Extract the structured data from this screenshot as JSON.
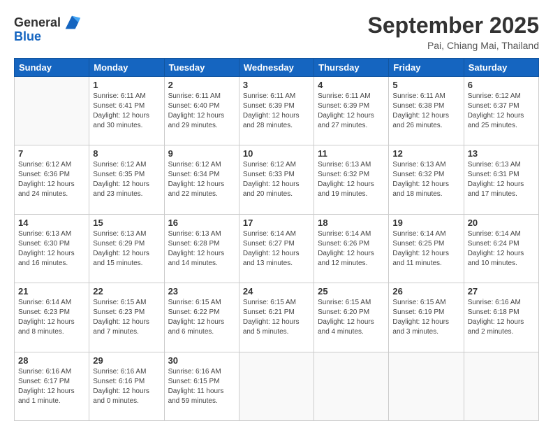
{
  "header": {
    "logo": {
      "line1": "General",
      "line2": "Blue"
    },
    "title": "September 2025",
    "subtitle": "Pai, Chiang Mai, Thailand"
  },
  "calendar": {
    "days_of_week": [
      "Sunday",
      "Monday",
      "Tuesday",
      "Wednesday",
      "Thursday",
      "Friday",
      "Saturday"
    ],
    "weeks": [
      [
        {
          "day": "",
          "info": ""
        },
        {
          "day": "1",
          "info": "Sunrise: 6:11 AM\nSunset: 6:41 PM\nDaylight: 12 hours\nand 30 minutes."
        },
        {
          "day": "2",
          "info": "Sunrise: 6:11 AM\nSunset: 6:40 PM\nDaylight: 12 hours\nand 29 minutes."
        },
        {
          "day": "3",
          "info": "Sunrise: 6:11 AM\nSunset: 6:39 PM\nDaylight: 12 hours\nand 28 minutes."
        },
        {
          "day": "4",
          "info": "Sunrise: 6:11 AM\nSunset: 6:39 PM\nDaylight: 12 hours\nand 27 minutes."
        },
        {
          "day": "5",
          "info": "Sunrise: 6:11 AM\nSunset: 6:38 PM\nDaylight: 12 hours\nand 26 minutes."
        },
        {
          "day": "6",
          "info": "Sunrise: 6:12 AM\nSunset: 6:37 PM\nDaylight: 12 hours\nand 25 minutes."
        }
      ],
      [
        {
          "day": "7",
          "info": "Sunrise: 6:12 AM\nSunset: 6:36 PM\nDaylight: 12 hours\nand 24 minutes."
        },
        {
          "day": "8",
          "info": "Sunrise: 6:12 AM\nSunset: 6:35 PM\nDaylight: 12 hours\nand 23 minutes."
        },
        {
          "day": "9",
          "info": "Sunrise: 6:12 AM\nSunset: 6:34 PM\nDaylight: 12 hours\nand 22 minutes."
        },
        {
          "day": "10",
          "info": "Sunrise: 6:12 AM\nSunset: 6:33 PM\nDaylight: 12 hours\nand 20 minutes."
        },
        {
          "day": "11",
          "info": "Sunrise: 6:13 AM\nSunset: 6:32 PM\nDaylight: 12 hours\nand 19 minutes."
        },
        {
          "day": "12",
          "info": "Sunrise: 6:13 AM\nSunset: 6:32 PM\nDaylight: 12 hours\nand 18 minutes."
        },
        {
          "day": "13",
          "info": "Sunrise: 6:13 AM\nSunset: 6:31 PM\nDaylight: 12 hours\nand 17 minutes."
        }
      ],
      [
        {
          "day": "14",
          "info": "Sunrise: 6:13 AM\nSunset: 6:30 PM\nDaylight: 12 hours\nand 16 minutes."
        },
        {
          "day": "15",
          "info": "Sunrise: 6:13 AM\nSunset: 6:29 PM\nDaylight: 12 hours\nand 15 minutes."
        },
        {
          "day": "16",
          "info": "Sunrise: 6:13 AM\nSunset: 6:28 PM\nDaylight: 12 hours\nand 14 minutes."
        },
        {
          "day": "17",
          "info": "Sunrise: 6:14 AM\nSunset: 6:27 PM\nDaylight: 12 hours\nand 13 minutes."
        },
        {
          "day": "18",
          "info": "Sunrise: 6:14 AM\nSunset: 6:26 PM\nDaylight: 12 hours\nand 12 minutes."
        },
        {
          "day": "19",
          "info": "Sunrise: 6:14 AM\nSunset: 6:25 PM\nDaylight: 12 hours\nand 11 minutes."
        },
        {
          "day": "20",
          "info": "Sunrise: 6:14 AM\nSunset: 6:24 PM\nDaylight: 12 hours\nand 10 minutes."
        }
      ],
      [
        {
          "day": "21",
          "info": "Sunrise: 6:14 AM\nSunset: 6:23 PM\nDaylight: 12 hours\nand 8 minutes."
        },
        {
          "day": "22",
          "info": "Sunrise: 6:15 AM\nSunset: 6:23 PM\nDaylight: 12 hours\nand 7 minutes."
        },
        {
          "day": "23",
          "info": "Sunrise: 6:15 AM\nSunset: 6:22 PM\nDaylight: 12 hours\nand 6 minutes."
        },
        {
          "day": "24",
          "info": "Sunrise: 6:15 AM\nSunset: 6:21 PM\nDaylight: 12 hours\nand 5 minutes."
        },
        {
          "day": "25",
          "info": "Sunrise: 6:15 AM\nSunset: 6:20 PM\nDaylight: 12 hours\nand 4 minutes."
        },
        {
          "day": "26",
          "info": "Sunrise: 6:15 AM\nSunset: 6:19 PM\nDaylight: 12 hours\nand 3 minutes."
        },
        {
          "day": "27",
          "info": "Sunrise: 6:16 AM\nSunset: 6:18 PM\nDaylight: 12 hours\nand 2 minutes."
        }
      ],
      [
        {
          "day": "28",
          "info": "Sunrise: 6:16 AM\nSunset: 6:17 PM\nDaylight: 12 hours\nand 1 minute."
        },
        {
          "day": "29",
          "info": "Sunrise: 6:16 AM\nSunset: 6:16 PM\nDaylight: 12 hours\nand 0 minutes."
        },
        {
          "day": "30",
          "info": "Sunrise: 6:16 AM\nSunset: 6:15 PM\nDaylight: 11 hours\nand 59 minutes."
        },
        {
          "day": "",
          "info": ""
        },
        {
          "day": "",
          "info": ""
        },
        {
          "day": "",
          "info": ""
        },
        {
          "day": "",
          "info": ""
        }
      ]
    ]
  }
}
